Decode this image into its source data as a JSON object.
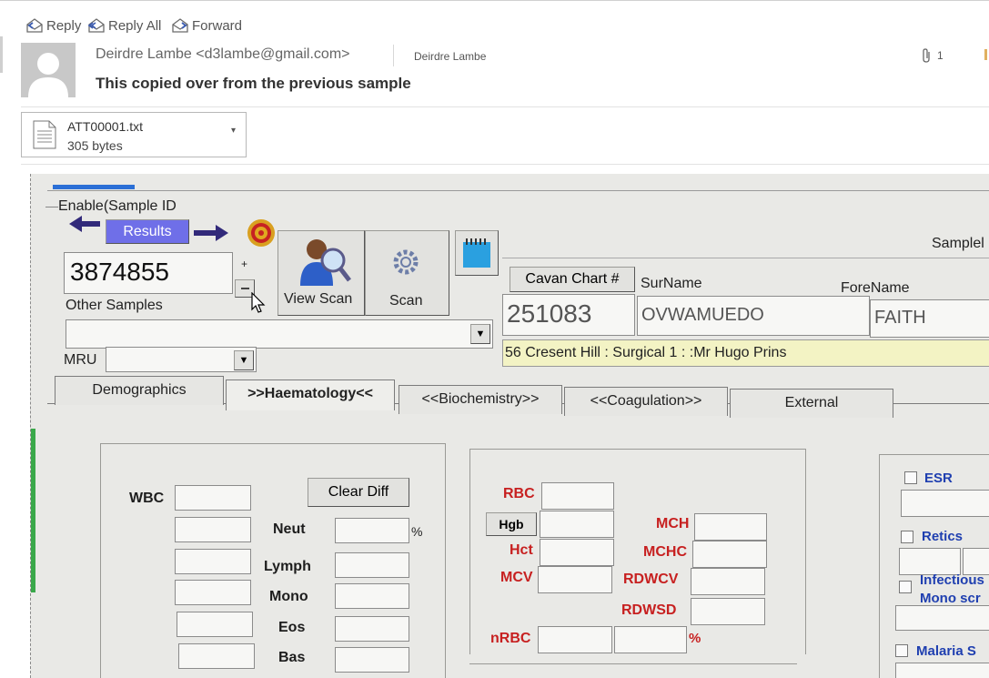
{
  "email": {
    "actions": {
      "reply": "Reply",
      "reply_all": "Reply All",
      "forward": "Forward"
    },
    "sender": "Deirdre Lambe <d3lambe@gmail.com>",
    "sender_short": "Deirdre Lambe",
    "attachment_count": "1",
    "subject": "This copied over from the previous sample",
    "attachment": {
      "name": "ATT00001.txt",
      "size": "305 bytes"
    }
  },
  "lis": {
    "enable_label": "Enable(Sample ID",
    "results_button": "Results",
    "sample_id": "3874855",
    "plus": "+",
    "other_samples_label": "Other Samples",
    "view_scan": "View Scan",
    "scan": "Scan",
    "mru_label": "MRU",
    "sample_label": "Samplel",
    "chart_label": "Cavan Chart #",
    "chart_no": "251083",
    "surname_label": "SurName",
    "surname": "OVWAMUEDO",
    "forename_label": "ForeName",
    "forename": "FAITH",
    "location": "56 Cresent Hill : Surgical 1 : :Mr Hugo Prins",
    "tabs": [
      "Demographics",
      ">>Haematology<<",
      "<<Biochemistry>>",
      "<<Coagulation>>",
      "External"
    ],
    "haem": {
      "wbc": "WBC",
      "clear_diff": "Clear Diff",
      "neut": "Neut",
      "percent": "%",
      "lymph": "Lymph",
      "mono": "Mono",
      "eos": "Eos",
      "bas": "Bas",
      "rbc": "RBC",
      "hgb": "Hgb",
      "hct": "Hct",
      "mcv": "MCV",
      "mch": "MCH",
      "mchc": "MCHC",
      "rdwcv": "RDWCV",
      "rdwsd": "RDWSD",
      "nrbc": "nRBC",
      "nrbc_pct": "%",
      "esr": "ESR",
      "retics": "Retics",
      "infectious": "Infectious",
      "mono_screen": "Mono scr",
      "malaria": "Malaria S"
    }
  }
}
